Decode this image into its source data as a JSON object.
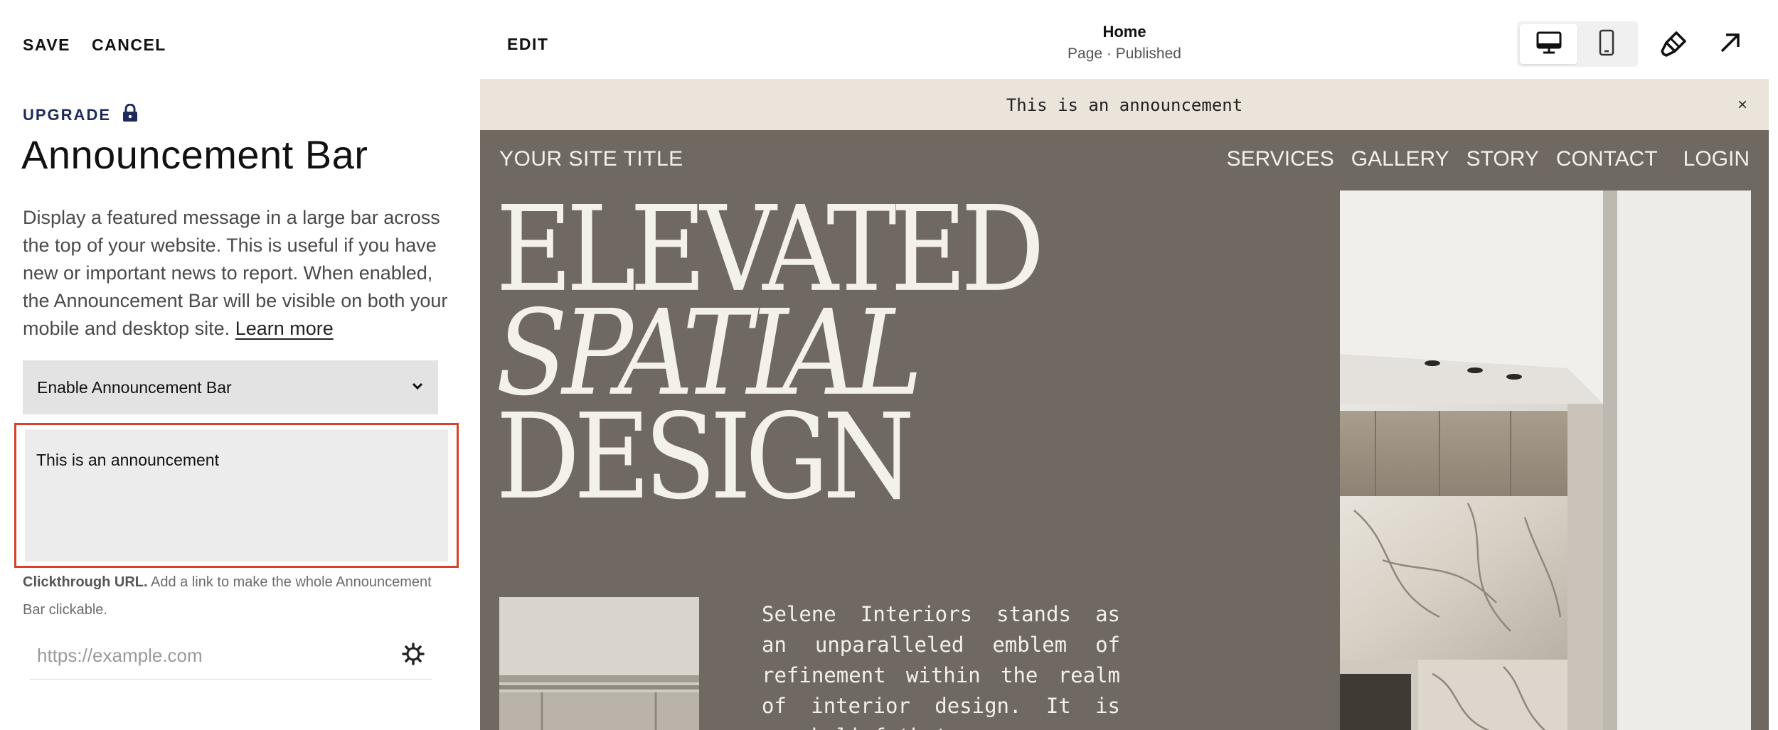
{
  "panel": {
    "save_label": "SAVE",
    "cancel_label": "CANCEL",
    "upgrade_label": "UPGRADE",
    "title": "Announcement Bar",
    "description": "Display a featured message in a large bar across the top of your website. This is useful if you have new or important news to report. When enabled, the Announcement Bar will be visible on both your mobile and desktop site.",
    "learn_more": "Learn more",
    "select_value": "Enable Announcement Bar",
    "announcement_text": "This is an announcement",
    "clickthrough_label": "Clickthrough URL.",
    "clickthrough_help": "Add a link to make the whole Announcement Bar clickable.",
    "url_placeholder": "https://example.com"
  },
  "preview_toolbar": {
    "edit_label": "EDIT",
    "page_title": "Home",
    "page_status": "Page · Published"
  },
  "announcement_bar": {
    "text": "This is an announcement",
    "close_glyph": "×"
  },
  "site": {
    "title": "YOUR SITE TITLE",
    "nav": [
      "SERVICES",
      "GALLERY",
      "STORY",
      "CONTACT"
    ],
    "login": "LOGIN",
    "hero_line1": "ELEVATED",
    "hero_line2": "SPATIAL",
    "hero_line3": "DESIGN",
    "body_copy": "Selene Interiors stands as an unparalleled emblem of refinement within the realm of interior design. It is our belief that"
  },
  "colors": {
    "accent_red": "#d8402b",
    "site_bg": "#6f6961",
    "announcement_bg": "#ebe4db",
    "upgrade_blue": "#1f2a5a"
  },
  "icons": {
    "lock": "lock-icon",
    "chevron": "chevron-down-icon",
    "gear": "gear-icon",
    "desktop": "desktop-icon",
    "mobile": "mobile-icon",
    "brush": "paintbrush-icon",
    "expand": "arrow-up-right-icon",
    "close": "close-icon"
  }
}
